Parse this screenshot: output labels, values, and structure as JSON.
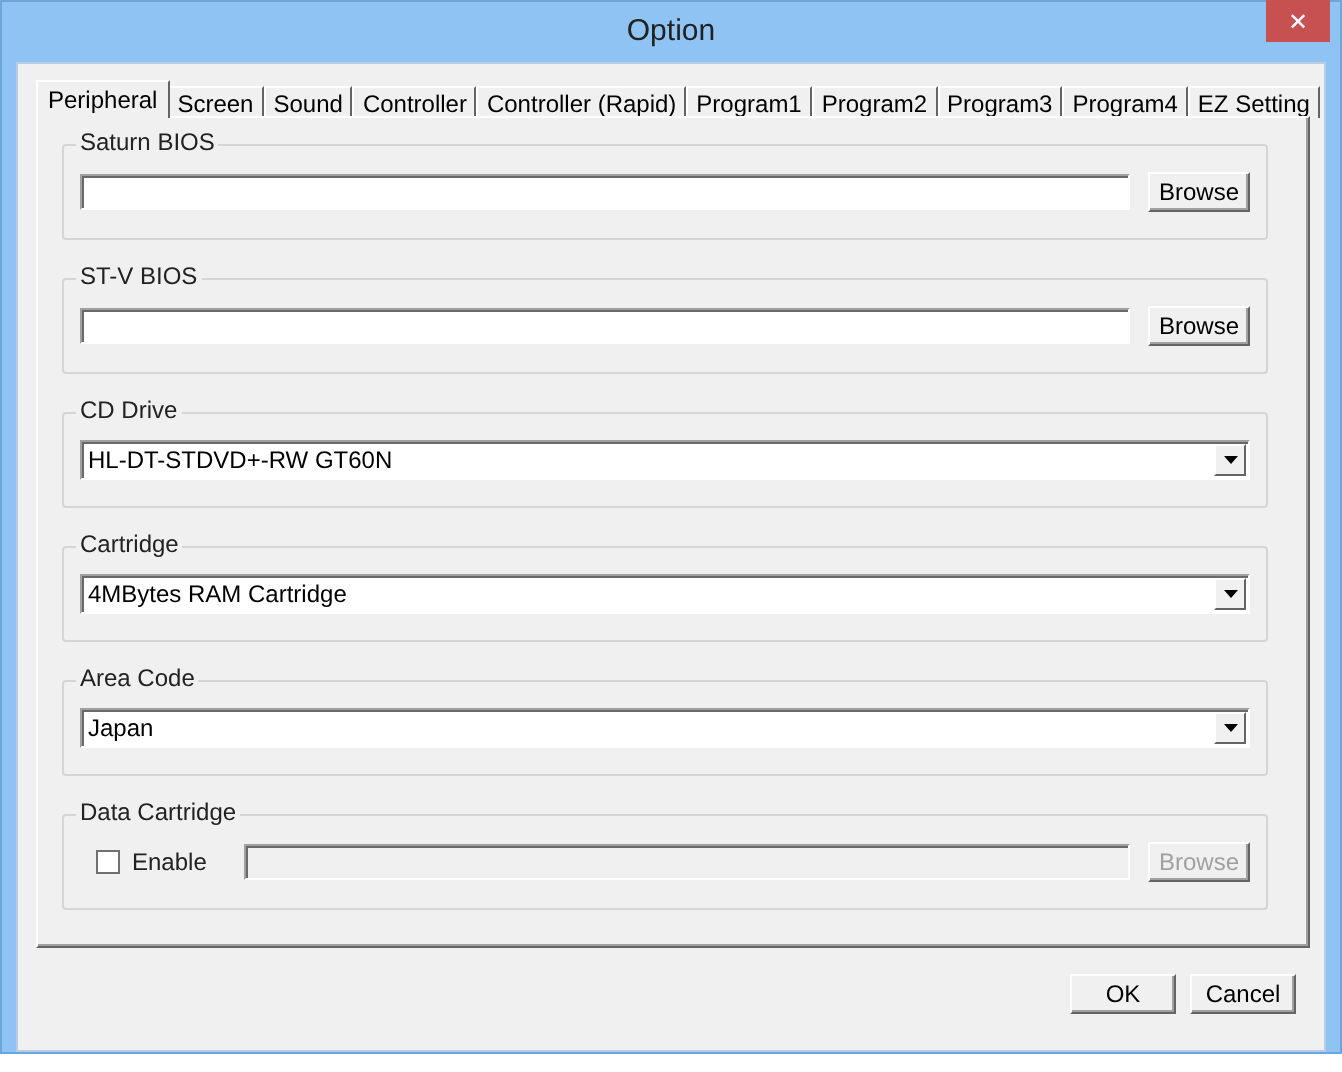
{
  "window": {
    "title": "Option",
    "close": "✕"
  },
  "tabs": [
    {
      "label": "Peripheral",
      "selected": true
    },
    {
      "label": "Screen",
      "selected": false
    },
    {
      "label": "Sound",
      "selected": false
    },
    {
      "label": "Controller",
      "selected": false
    },
    {
      "label": "Controller (Rapid)",
      "selected": false
    },
    {
      "label": "Program1",
      "selected": false
    },
    {
      "label": "Program2",
      "selected": false
    },
    {
      "label": "Program3",
      "selected": false
    },
    {
      "label": "Program4",
      "selected": false
    },
    {
      "label": "EZ Setting",
      "selected": false
    }
  ],
  "groups": [
    {
      "kind": "file",
      "title": "Saturn BIOS",
      "button": "Browse",
      "disabled": false
    },
    {
      "kind": "file",
      "title": "ST-V BIOS",
      "button": "Browse",
      "disabled": false
    },
    {
      "kind": "select",
      "title": "CD Drive",
      "value": "HL-DT-STDVD+-RW GT60N"
    },
    {
      "kind": "select",
      "title": "Cartridge",
      "value": "4MBytes RAM Cartridge"
    },
    {
      "kind": "select",
      "title": "Area Code",
      "value": "Japan"
    },
    {
      "kind": "file",
      "title": "Data Cartridge",
      "checkbox": {
        "label": "Enable",
        "checked": false
      },
      "button": "Browse",
      "disabled": true
    }
  ],
  "buttons": [
    "OK",
    "Cancel"
  ]
}
